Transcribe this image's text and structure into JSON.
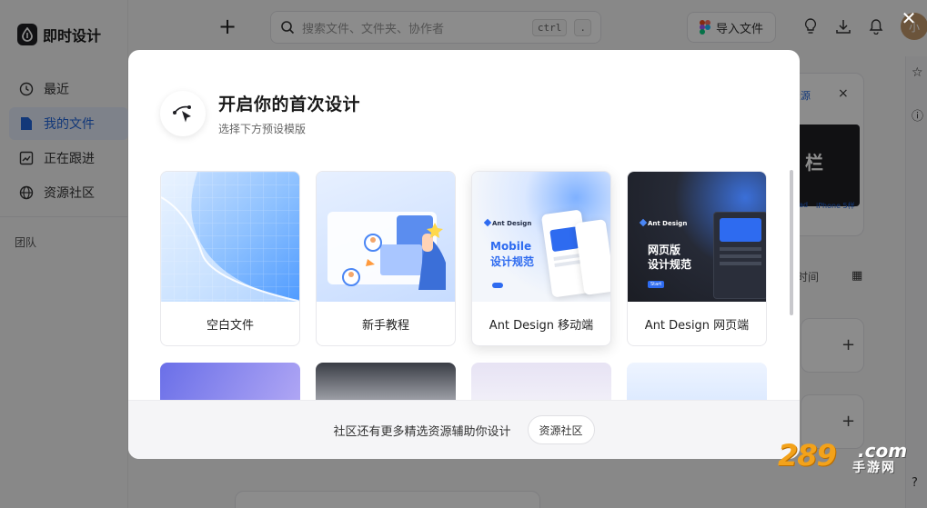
{
  "app": {
    "logo_text": "即时设计",
    "nav": [
      {
        "label": "最近",
        "icon": "clock-icon"
      },
      {
        "label": "我的文件",
        "icon": "file-icon"
      },
      {
        "label": "正在跟进",
        "icon": "follow-icon"
      },
      {
        "label": "资源社区",
        "icon": "globe-icon"
      }
    ],
    "team_label": "团队",
    "search_placeholder": "搜索文件、文件夹、协作者",
    "search_shortcut_1": "ctrl",
    "search_shortcut_2": ".",
    "import_label": "导入文件",
    "avatar_text": "小",
    "bg_resource_link": "资源",
    "bg_sort_label": "时间",
    "bg_banner_text_1": "栏",
    "bg_banner_text_2": "pad",
    "bg_banner_text_3": "iPhone 5样"
  },
  "modal": {
    "title": "开启你的首次设计",
    "subtitle": "选择下方预设模版",
    "templates": [
      {
        "label": "空白文件"
      },
      {
        "label": "新手教程"
      },
      {
        "label": "Ant Design 移动端",
        "thumb_brand": "Ant Design",
        "thumb_title_1": "Mobile",
        "thumb_title_2": "设计规范"
      },
      {
        "label": "Ant Design 网页端",
        "thumb_brand": "Ant Design",
        "thumb_title_1": "网页版",
        "thumb_title_2": "设计规范",
        "thumb_btn": "Start"
      }
    ],
    "footer_text": "社区还有更多精选资源辅助你设计",
    "footer_button": "资源社区"
  },
  "watermark": {
    "num": "289",
    "com": ".com",
    "cn": "手游网"
  },
  "colors": {
    "accent": "#2266dd",
    "overlay": "rgba(0,0,0,0.45)"
  }
}
